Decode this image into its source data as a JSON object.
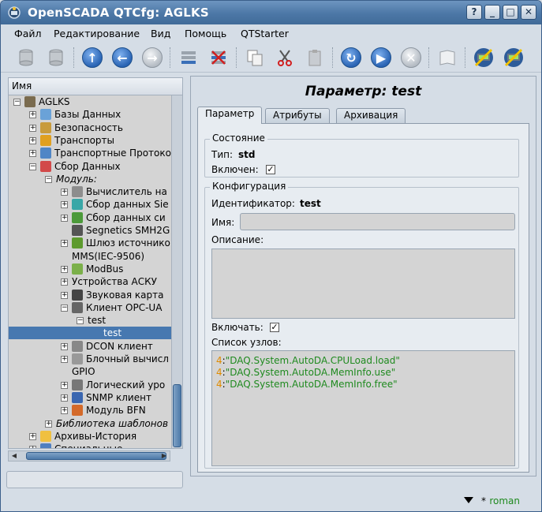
{
  "window": {
    "title": "OpenSCADA QTCfg: AGLKS",
    "controls": [
      "help-icon",
      "minimize-icon",
      "maximize-icon",
      "close-icon"
    ]
  },
  "menu": [
    {
      "label": "Файл"
    },
    {
      "label": "Редактирование"
    },
    {
      "label": "Вид"
    },
    {
      "label": "Помощь"
    },
    {
      "label": "QTStarter"
    }
  ],
  "toolbar": {
    "icons": [
      "db-load-icon",
      "db-save-icon",
      "up-icon",
      "back-icon",
      "forward-icon",
      "add-item-icon",
      "delete-item-icon",
      "copy-icon",
      "cut-icon",
      "paste-icon",
      "refresh-icon",
      "start-icon",
      "stop-icon",
      "manual-icon",
      "about-program-icon",
      "about-qt-icon"
    ]
  },
  "tree": {
    "header": "Имя",
    "rows": [
      {
        "label": "AGLKS",
        "expander": "−",
        "icon": "station-icon"
      },
      {
        "label": "Базы Данных",
        "expander": "+",
        "icon": "database-icon"
      },
      {
        "label": "Безопасность",
        "expander": "+",
        "icon": "security-icon"
      },
      {
        "label": "Транспорты",
        "expander": "+",
        "icon": "transport-icon"
      },
      {
        "label": "Транспортные Протоко",
        "expander": "+",
        "icon": "protocol-icon"
      },
      {
        "label": "Сбор Данных",
        "expander": "−",
        "icon": "daq-icon"
      },
      {
        "label": "Модуль:",
        "expander": "−",
        "icon": ""
      },
      {
        "label": "Вычислитель на",
        "expander": "+",
        "icon": "calculator-icon"
      },
      {
        "label": "Сбор данных Sie",
        "expander": "+",
        "icon": "siemens-icon"
      },
      {
        "label": "Сбор данных си",
        "expander": "+",
        "icon": "system-icon"
      },
      {
        "label": "Segnetics SMH2G",
        "expander": "",
        "icon": "segnetics-icon"
      },
      {
        "label": "Шлюз источнико",
        "expander": "+",
        "icon": "gateway-icon"
      },
      {
        "label": "MMS(IEC-9506)",
        "expander": "",
        "icon": ""
      },
      {
        "label": "ModBus",
        "expander": "+",
        "icon": "modbus-icon"
      },
      {
        "label": "Устройства АСКУ",
        "expander": "+",
        "icon": ""
      },
      {
        "label": "Звуковая карта",
        "expander": "+",
        "icon": "microphone-icon"
      },
      {
        "label": "Клиент OPC-UA",
        "expander": "−",
        "icon": "opcua-icon"
      },
      {
        "label": "test",
        "expander": "−",
        "icon": ""
      },
      {
        "label": "test",
        "expander": "",
        "icon": ""
      },
      {
        "label": "DCON клиент",
        "expander": "+",
        "icon": "dcon-icon"
      },
      {
        "label": "Блочный вычисл",
        "expander": "+",
        "icon": "block-icon"
      },
      {
        "label": "GPIO",
        "expander": "",
        "icon": ""
      },
      {
        "label": "Логический уро",
        "expander": "+",
        "icon": "logic-icon"
      },
      {
        "label": "SNMP клиент",
        "expander": "+",
        "icon": "snmp-icon"
      },
      {
        "label": "Модуль BFN",
        "expander": "+",
        "icon": "bfn-icon"
      },
      {
        "label": "Библиотека шаблонов",
        "expander": "+",
        "icon": ""
      },
      {
        "label": "Архивы-История",
        "expander": "+",
        "icon": "archive-icon"
      },
      {
        "label": "Специальные",
        "expander": "+",
        "icon": "special-icon"
      }
    ]
  },
  "page": {
    "title": "Параметр: test",
    "tabs": [
      "Параметр",
      "Атрибуты",
      "Архивация"
    ],
    "state": {
      "legend": "Состояние",
      "type_label": "Тип:",
      "type_value": "std",
      "enabled_label": "Включен:",
      "enabled": "✓"
    },
    "config": {
      "legend": "Конфигурация",
      "id_label": "Идентификатор:",
      "id_value": "test",
      "name_label": "Имя:",
      "name_value": "",
      "descr_label": "Описание:",
      "descr_value": "",
      "to_enable_label": "Включать:",
      "to_enable": "✓",
      "nodes_label": "Список узлов:",
      "nodes": [
        {
          "num": "4",
          "sep": ":",
          "str": "\"DAQ.System.AutoDA.CPULoad.load\""
        },
        {
          "num": "4",
          "sep": ":",
          "str": "\"DAQ.System.AutoDA.MemInfo.use\""
        },
        {
          "num": "4",
          "sep": ":",
          "str": "\"DAQ.System.AutoDA.MemInfo.free\""
        }
      ]
    }
  },
  "status": {
    "modified_mark": "*",
    "user": "roman"
  }
}
